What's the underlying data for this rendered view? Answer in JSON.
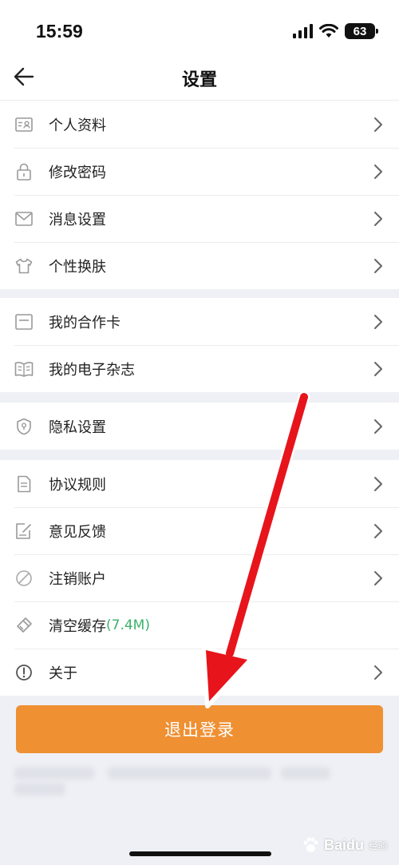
{
  "status_bar": {
    "time": "15:59",
    "battery": "63"
  },
  "header": {
    "title": "设置"
  },
  "groups": [
    {
      "items": [
        {
          "label": "个人资料",
          "icon": "id-card-icon"
        },
        {
          "label": "修改密码",
          "icon": "lock-icon"
        },
        {
          "label": "消息设置",
          "icon": "mail-icon"
        },
        {
          "label": "个性换肤",
          "icon": "shirt-icon"
        }
      ]
    },
    {
      "items": [
        {
          "label": "我的合作卡",
          "icon": "card-icon"
        },
        {
          "label": "我的电子杂志",
          "icon": "book-icon"
        }
      ]
    },
    {
      "items": [
        {
          "label": "隐私设置",
          "icon": "shield-icon"
        }
      ]
    },
    {
      "items": [
        {
          "label": "协议规则",
          "icon": "document-icon"
        },
        {
          "label": "意见反馈",
          "icon": "feedback-icon"
        },
        {
          "label": "注销账户",
          "icon": "ban-icon"
        },
        {
          "label": "清空缓存",
          "extra": "(7.4M)",
          "icon": "broom-icon"
        },
        {
          "label": "关于",
          "icon": "info-icon"
        }
      ]
    }
  ],
  "logout_label": "退出登录",
  "watermark": {
    "brand": "Baidu",
    "sub": "经验"
  },
  "colors": {
    "accent": "#ef9033",
    "cache_size": "#3bb26b",
    "annotation_arrow": "#e8141b"
  }
}
